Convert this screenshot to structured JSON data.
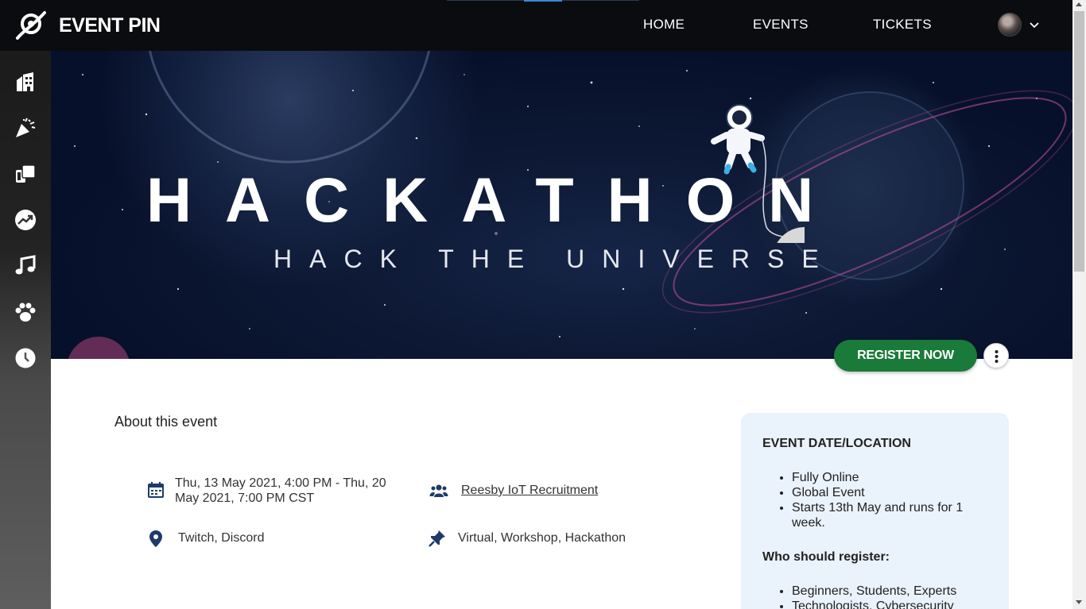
{
  "app": {
    "brand": "EVENT PIN",
    "logo_icon": "orbit-pin-logo-icon"
  },
  "nav": {
    "items": [
      {
        "label": "HOME"
      },
      {
        "label": "EVENTS"
      },
      {
        "label": "TICKETS"
      }
    ],
    "user_menu_icon": "chevron-down-icon"
  },
  "sidebar": {
    "icons": [
      "building-icon",
      "party-popper-icon",
      "theater-icon",
      "trending-icon",
      "music-note-icon",
      "paw-icon",
      "clock-icon"
    ]
  },
  "hero": {
    "title": "HACKATHON",
    "subtitle": "HACK THE UNIVERSE"
  },
  "actions": {
    "register_label": "REGISTER NOW",
    "more_icon": "more-vertical-icon",
    "register_color": "#1a7a3a"
  },
  "about": {
    "title": "About this event",
    "date_time": "Thu, 13 May 2021, 4:00 PM - Thu, 20 May 2021, 7:00 PM CST",
    "organizer": "Reesby IoT Recruitment",
    "location": "Twitch, Discord",
    "tags": "Virtual, Workshop, Hackathon"
  },
  "card": {
    "heading": "EVENT DATE/LOCATION",
    "items": [
      "Fully Online",
      "Global Event",
      "Starts 13th May and runs for 1 week."
    ],
    "who_heading": "Who should register:",
    "who_items": [
      "Beginners, Students, Experts",
      "Technologists, Cybersecurity"
    ]
  }
}
